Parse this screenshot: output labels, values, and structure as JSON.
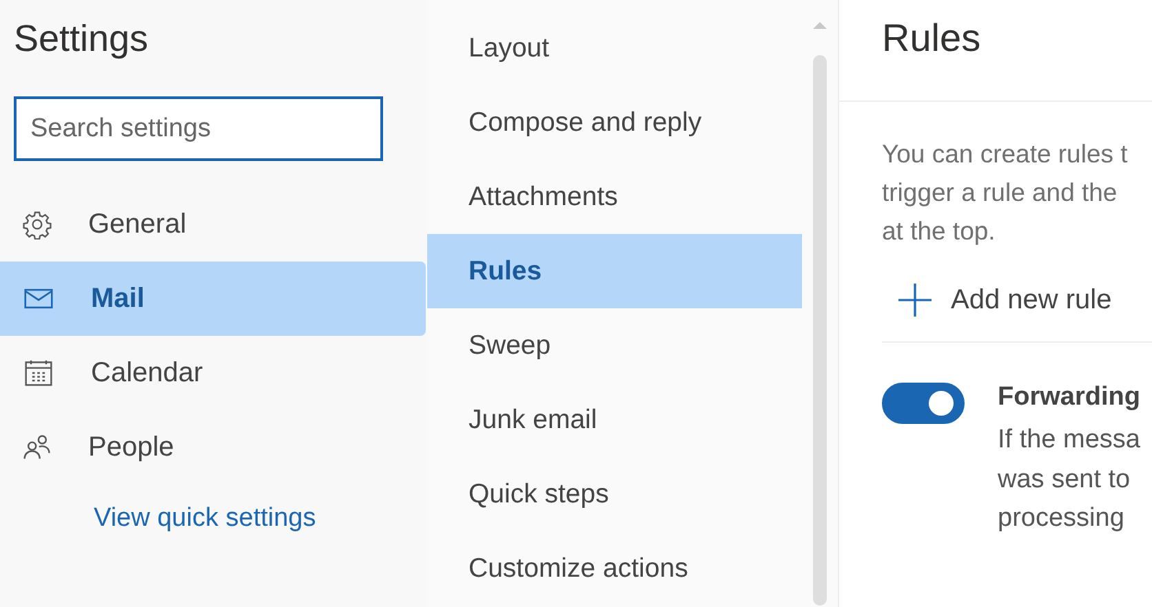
{
  "sidebar": {
    "title": "Settings",
    "search": {
      "placeholder": "Search settings"
    },
    "items": [
      {
        "label": "General",
        "kind": "gear",
        "selected": false
      },
      {
        "label": "Mail",
        "kind": "mail",
        "selected": true
      },
      {
        "label": "Calendar",
        "kind": "calendar",
        "selected": false
      },
      {
        "label": "People",
        "kind": "people",
        "selected": false
      }
    ],
    "link": "View quick settings"
  },
  "submenu": {
    "items": [
      {
        "label": "Layout",
        "selected": false
      },
      {
        "label": "Compose and reply",
        "selected": false
      },
      {
        "label": "Attachments",
        "selected": false
      },
      {
        "label": "Rules",
        "selected": true
      },
      {
        "label": "Sweep",
        "selected": false
      },
      {
        "label": "Junk email",
        "selected": false
      },
      {
        "label": "Quick steps",
        "selected": false
      },
      {
        "label": "Customize actions",
        "selected": false
      }
    ]
  },
  "content": {
    "title": "Rules",
    "description_lines": [
      "You can create rules t",
      "trigger a rule and the",
      "at the top."
    ],
    "add_button": "Add new rule",
    "rules": [
      {
        "name": "Forwarding",
        "on": true,
        "description_lines": [
          "If the messa",
          "was sent to",
          "processing"
        ]
      }
    ]
  }
}
